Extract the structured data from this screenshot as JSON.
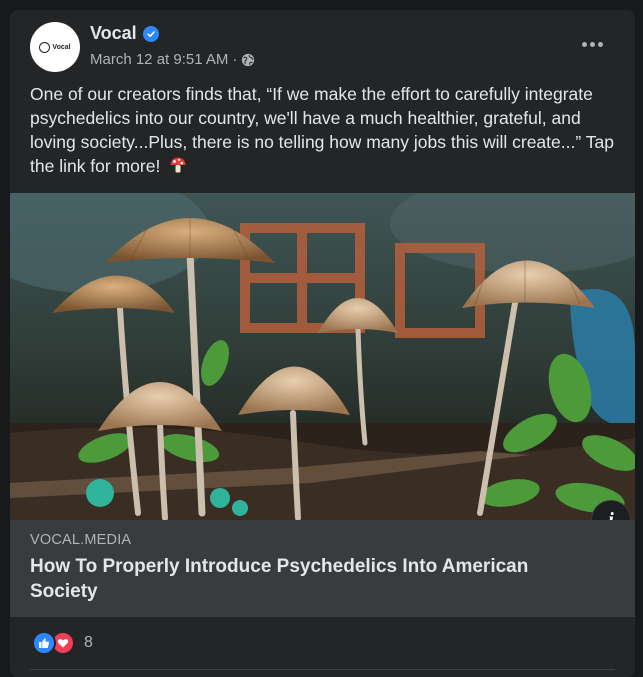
{
  "post": {
    "page_name": "Vocal",
    "avatar_text": "Vocal",
    "timestamp": "March 12 at 9:51 AM",
    "separator": "·",
    "text": "One of our creators finds that, “If we make the effort to carefully integrate psychedelics into our country, we'll have a much healthier, grateful, and loving society...Plus, there is no telling how many jobs this will create...” Tap the link for more!"
  },
  "link_preview": {
    "domain": "VOCAL.MEDIA",
    "title": "How To Properly Introduce Psychedelics Into American Society",
    "info_label": "i"
  },
  "reactions": {
    "count": "8",
    "types": [
      "like-icon",
      "love-icon"
    ]
  },
  "icons": {
    "verified": "verified-badge-icon",
    "audience": "globe-icon",
    "more": "more-options-icon",
    "emoji": "mushroom-emoji-icon"
  },
  "colors": {
    "background": "#18191a",
    "card": "#242526",
    "link_meta_bg": "#3a3b3c",
    "primary_text": "#e4e6eb",
    "secondary_text": "#b0b3b8",
    "verified_blue": "#2d88ff",
    "like_blue": "#2d88ff",
    "love_red": "#f33e58"
  }
}
